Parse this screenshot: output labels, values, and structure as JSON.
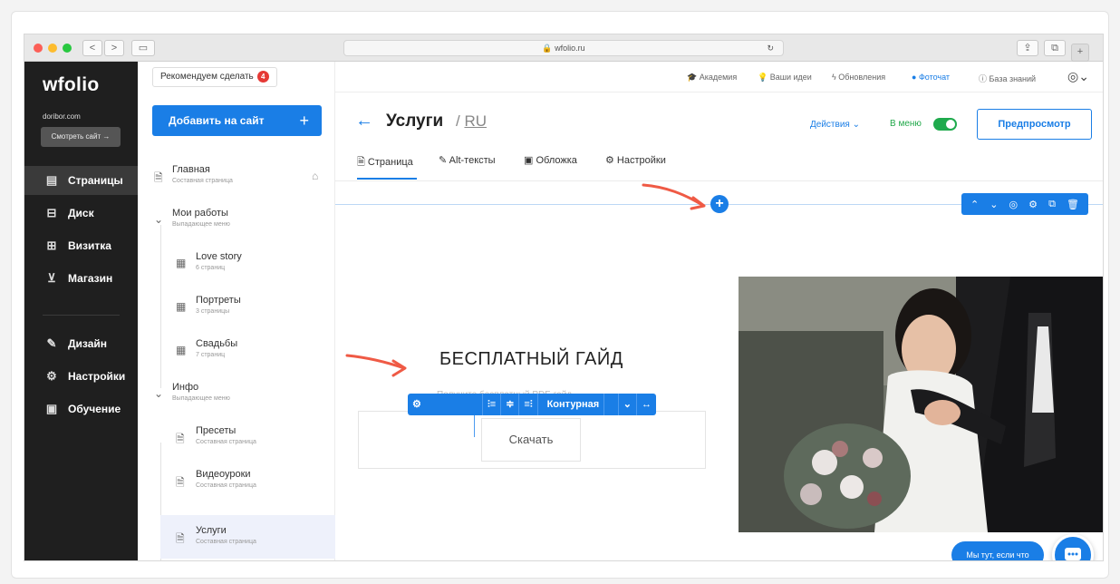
{
  "browser": {
    "url": "wfolio.ru",
    "nav_back": "<",
    "nav_fwd": ">"
  },
  "sidebar": {
    "logo": "wfolio",
    "domain": "doribor.com",
    "view_site": "Смотреть сайт →",
    "items": [
      {
        "label": "Страницы",
        "icon": "page-icon",
        "glyph": "▤"
      },
      {
        "label": "Диск",
        "icon": "disk-icon",
        "glyph": "⊟"
      },
      {
        "label": "Визитка",
        "icon": "card-icon",
        "glyph": "⊞"
      },
      {
        "label": "Магазин",
        "icon": "cart-icon",
        "glyph": "⊻"
      },
      {
        "label": "Дизайн",
        "icon": "brush-icon",
        "glyph": "✎"
      },
      {
        "label": "Настройки",
        "icon": "gear-icon",
        "glyph": "⚙"
      },
      {
        "label": "Обучение",
        "icon": "book-icon",
        "glyph": "▣"
      }
    ]
  },
  "tree": {
    "recommend": "Рекомендуем сделать",
    "recommend_count": "4",
    "add_button": "Добавить на сайт",
    "add_plus": "+",
    "items": [
      {
        "title": "Главная",
        "sub": "Составная страница"
      },
      {
        "title": "Мои работы",
        "sub": "Выпадающее меню"
      },
      {
        "title": "Love story",
        "sub": "6 страниц"
      },
      {
        "title": "Портреты",
        "sub": "3 страницы"
      },
      {
        "title": "Свадьбы",
        "sub": "7 страниц"
      },
      {
        "title": "Инфо",
        "sub": "Выпадающее меню"
      },
      {
        "title": "Пресеты",
        "sub": "Составная страница"
      },
      {
        "title": "Видеоуроки",
        "sub": "Составная страница"
      },
      {
        "title": "Услуги",
        "sub": "Составная страница"
      }
    ]
  },
  "topbar": {
    "academy": "Академия",
    "ideas": "Ваши идеи",
    "updates": "Обновления",
    "photochat": "Фоточат",
    "kb": "База знаний"
  },
  "page": {
    "back": "←",
    "title": "Услуги",
    "lang": "RU",
    "actions": "Действия ⌄",
    "in_menu": "В меню",
    "preview": "Предпросмотр",
    "tabs": [
      "Страница",
      "Alt-тексты",
      "Обложка",
      "Настройки"
    ]
  },
  "block": {
    "guide_title": "БЕСПЛАТНЫЙ ГАЙД",
    "guide_sub": "Получите бесплатный PDF-гайд",
    "download": "Скачать",
    "toolbar_settings": "Настройки",
    "toolbar_style": "Контурная",
    "block_toolbar": [
      "⌃",
      "⌄",
      "◎",
      "⚙",
      "⧉",
      "🗑"
    ]
  },
  "chat": {
    "label": "Мы тут, если что"
  },
  "colors": {
    "accent": "#1a7ee6",
    "sidebar": "#1f1f1f",
    "toggle": "#1faa4d",
    "arrow": "#ef5a45"
  }
}
